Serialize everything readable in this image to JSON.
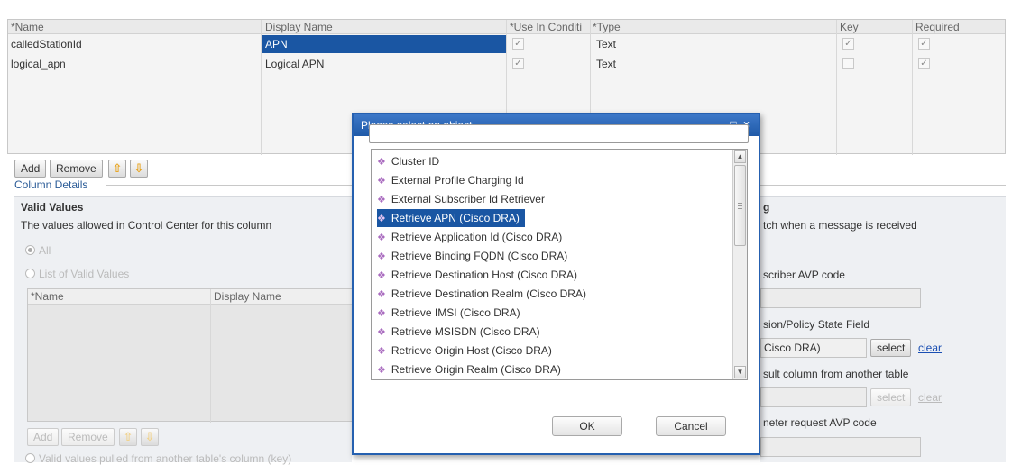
{
  "grid": {
    "columns": [
      "*Name",
      "Display Name",
      "*Use In Conditi",
      "*Type",
      "Key",
      "Required"
    ],
    "rows": [
      {
        "name": "calledStationId",
        "display": "APN",
        "type": "Text"
      },
      {
        "name": "logical_apn",
        "display": "Logical APN",
        "type": "Text"
      }
    ],
    "buttons": {
      "add": "Add",
      "remove": "Remove"
    }
  },
  "column_details": {
    "label": "Column Details",
    "valid_values": {
      "title": "Valid Values",
      "desc": "The values allowed in Control Center for this column",
      "opt_all": "All",
      "opt_list": "List of Valid Values",
      "sub_columns": [
        "*Name",
        "Display Name"
      ],
      "buttons": {
        "add": "Add",
        "remove": "Remove"
      },
      "opt_pulled": "Valid values pulled from another table's column (key)"
    },
    "right": {
      "title_fragment": "g",
      "desc_fragment": "tch when a message is received",
      "subscriber_avp": "scriber AVP code",
      "session_state": "sion/Policy State Field",
      "selected_value": "Cisco DRA)",
      "select_label": "select",
      "clear_label": "clear",
      "result_column": "sult column from another table",
      "diameter_avp": "neter request AVP code"
    }
  },
  "modal": {
    "title": "Please select an object...",
    "title_icons": "□ ×",
    "search_value": "",
    "items": [
      "Cluster ID",
      "External Profile Charging Id",
      "External Subscriber Id Retriever",
      "Retrieve APN (Cisco DRA)",
      "Retrieve Application Id (Cisco DRA)",
      "Retrieve Binding FQDN (Cisco DRA)",
      "Retrieve Destination Host (Cisco DRA)",
      "Retrieve Destination Realm (Cisco DRA)",
      "Retrieve IMSI (Cisco DRA)",
      "Retrieve MSISDN (Cisco DRA)",
      "Retrieve Origin Host (Cisco DRA)",
      "Retrieve Origin Realm (Cisco DRA)"
    ],
    "selected_index": 3,
    "ok_label": "OK",
    "cancel_label": "Cancel"
  },
  "icons": {
    "list_item": "purple-diamond-icon",
    "move_up": "arrow-up-icon",
    "move_down": "arrow-down-icon"
  },
  "colors": {
    "selection": "#1a56a3",
    "title_bar": "#2560b0",
    "link": "#1a4fb3",
    "section_label": "#2a5b97"
  }
}
